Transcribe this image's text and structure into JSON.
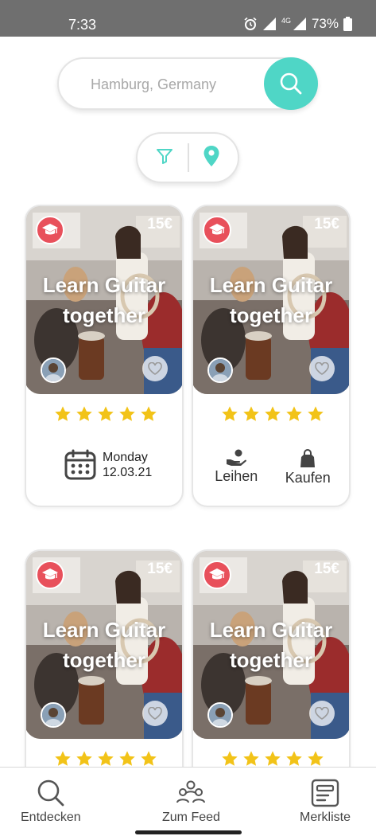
{
  "status_bar": {
    "time": "7:33",
    "battery": "73%",
    "network": "4G"
  },
  "search": {
    "placeholder": "Hamburg, Germany",
    "value": ""
  },
  "filter_pill": {
    "icons": [
      "filter-icon",
      "location-pin-icon"
    ]
  },
  "colors": {
    "accent": "#4fd6c6",
    "badge": "#e8505b",
    "star": "#f2c318"
  },
  "cards": [
    {
      "price": "15€",
      "title": "Learn Guitar together",
      "rating": 5,
      "footer": "date",
      "day": "Monday",
      "date": "12.03.21"
    },
    {
      "price": "15€",
      "title": "Learn Guitar together",
      "rating": 5,
      "footer": "actions",
      "rent_label": "Leihen",
      "buy_label": "Kaufen"
    },
    {
      "price": "15€",
      "title": "Learn Guitar together",
      "rating": 5
    },
    {
      "price": "15€",
      "title": "Learn Guitar together",
      "rating": 5
    }
  ],
  "bottom_nav": {
    "items": [
      {
        "label": "Entdecken",
        "icon": "search-icon"
      },
      {
        "label": "Zum Feed",
        "icon": "group-icon"
      },
      {
        "label": "Merkliste",
        "icon": "bookmark-list-icon"
      }
    ]
  }
}
